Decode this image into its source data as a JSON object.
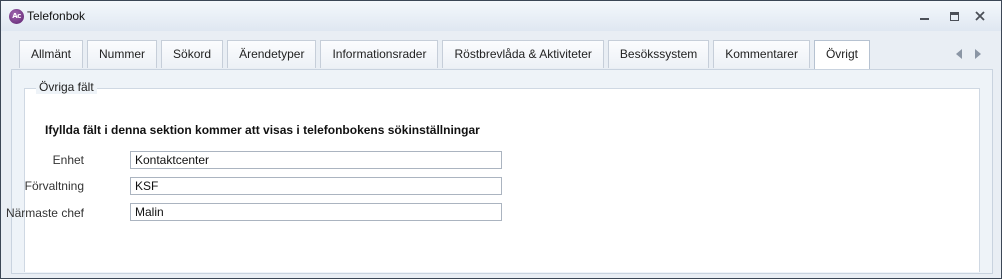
{
  "window": {
    "title": "Telefonbok",
    "app_icon_label": "Ac"
  },
  "tabs": [
    {
      "label": "Allmänt",
      "active": false
    },
    {
      "label": "Nummer",
      "active": false
    },
    {
      "label": "Sökord",
      "active": false
    },
    {
      "label": "Ärendetyper",
      "active": false
    },
    {
      "label": "Informationsrader",
      "active": false
    },
    {
      "label": "Röstbrevlåda & Aktiviteter",
      "active": false
    },
    {
      "label": "Besökssystem",
      "active": false
    },
    {
      "label": "Kommentarer",
      "active": false
    },
    {
      "label": "Övrigt",
      "active": true
    }
  ],
  "panel": {
    "group_title": "Övriga fält",
    "section_title": "Ifyllda fält i denna sektion kommer att visas i telefonbokens sökinställningar",
    "fields": [
      {
        "label": "Enhet",
        "value": "Kontaktcenter"
      },
      {
        "label": "Förvaltning",
        "value": "KSF"
      },
      {
        "label": "Närmaste chef",
        "value": "Malin"
      }
    ]
  }
}
